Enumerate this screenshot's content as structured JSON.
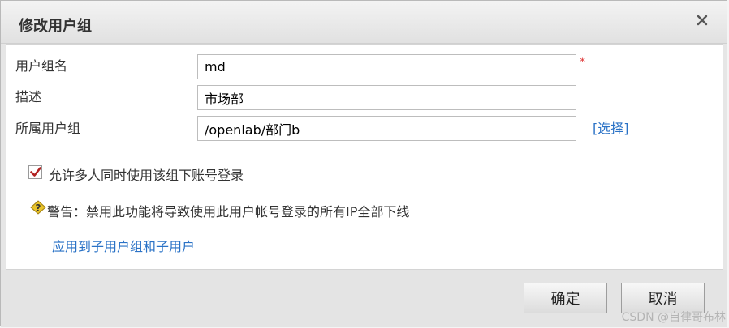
{
  "dialog": {
    "title": "修改用户组",
    "close_icon": "close-icon"
  },
  "form": {
    "group_name": {
      "label": "用户组名",
      "value": "md",
      "required_mark": "*"
    },
    "description": {
      "label": "描述",
      "value": "市场部"
    },
    "parent_group": {
      "label": "所属用户组",
      "value": "/openlab/部门b",
      "select_label": "[选择]"
    }
  },
  "options": {
    "allow_multi_login": {
      "label": "允许多人同时使用该组下账号登录",
      "checked": true
    }
  },
  "warning": {
    "icon": "warning-icon",
    "text": "警告：禁用此功能将导致使用此用户帐号登录的所有IP全部下线"
  },
  "apply_link": "应用到子用户组和子用户",
  "buttons": {
    "ok": "确定",
    "cancel": "取消"
  },
  "watermark": "CSDN @自律哥布林",
  "colors": {
    "link": "#2a72c6",
    "required": "#e03a3a",
    "checkbox": "#b22222",
    "warning": "#e8c32b"
  }
}
